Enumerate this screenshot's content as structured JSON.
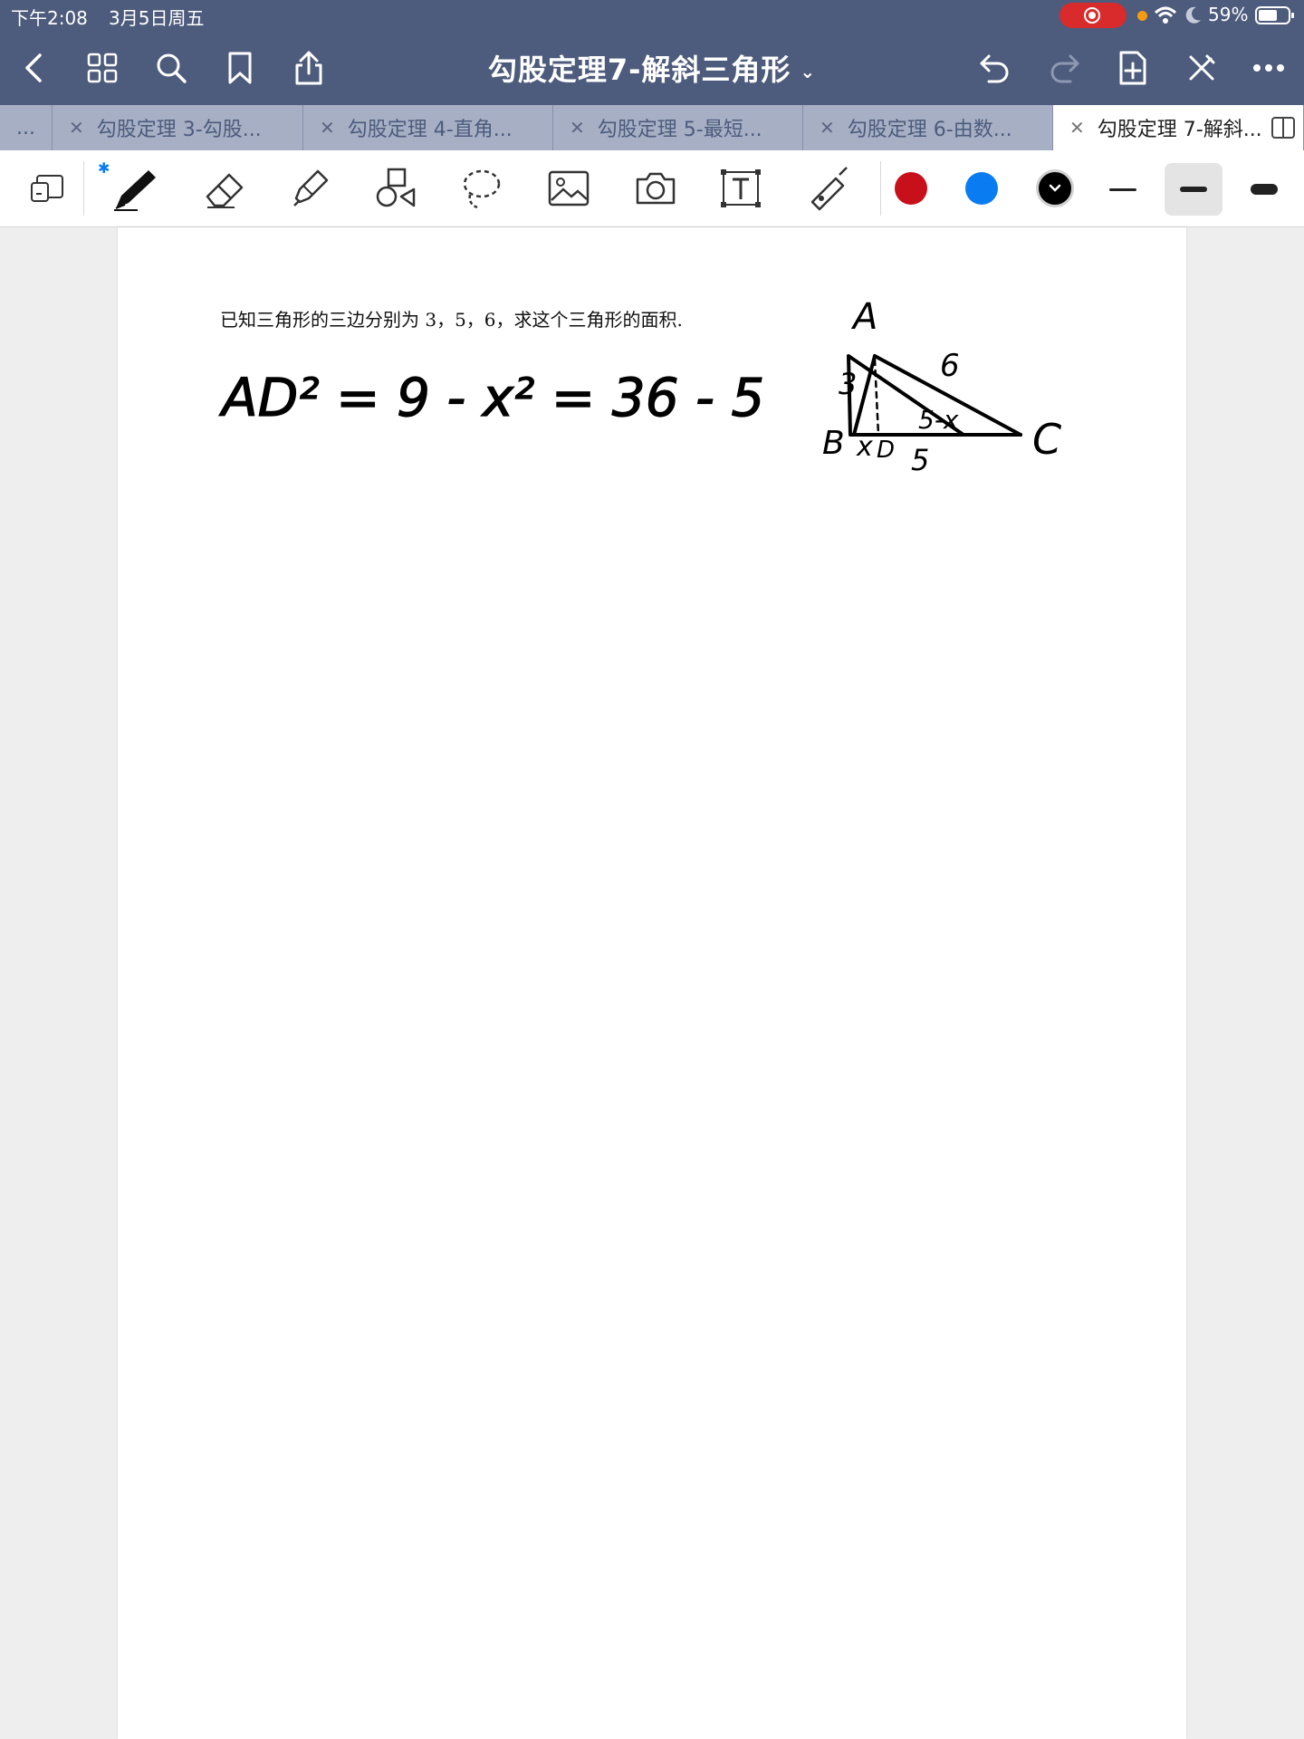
{
  "status": {
    "time": "下午2:08",
    "date": "3月5日周五",
    "battery": "59%"
  },
  "nav": {
    "title": "勾股定理7-解斜三角形",
    "icons": [
      "back-icon",
      "grid-icon",
      "search-icon",
      "bookmark-icon",
      "share-icon",
      "undo-icon",
      "redo-icon",
      "add-page-icon",
      "pen-off-icon",
      "more-icon"
    ]
  },
  "tabs": [
    {
      "label": "..."
    },
    {
      "label": "勾股定理 3-勾股..."
    },
    {
      "label": "勾股定理 4-直角..."
    },
    {
      "label": "勾股定理 5-最短..."
    },
    {
      "label": "勾股定理 6-由数..."
    },
    {
      "label": "勾股定理 7-解斜...",
      "active": true
    }
  ],
  "toolbar": {
    "bluetooth": "✱",
    "colors": [
      "#c8101a",
      "#0a7cf2",
      "#000000"
    ],
    "active_color": "#000000",
    "active_width": "medium"
  },
  "document": {
    "question": "已知三角形的三边分别为 3，5，6，求这个三角形的面积.",
    "handwriting": {
      "equation": "AD² = 9 - x² = 36 - 5",
      "vertex_a": "A",
      "vertex_b": "B",
      "vertex_c": "C",
      "side_ab": "3",
      "side_ac": "6",
      "side_bc": "5",
      "seg_bd": "x",
      "seg_dc": "5-x",
      "foot_d": "D"
    }
  }
}
